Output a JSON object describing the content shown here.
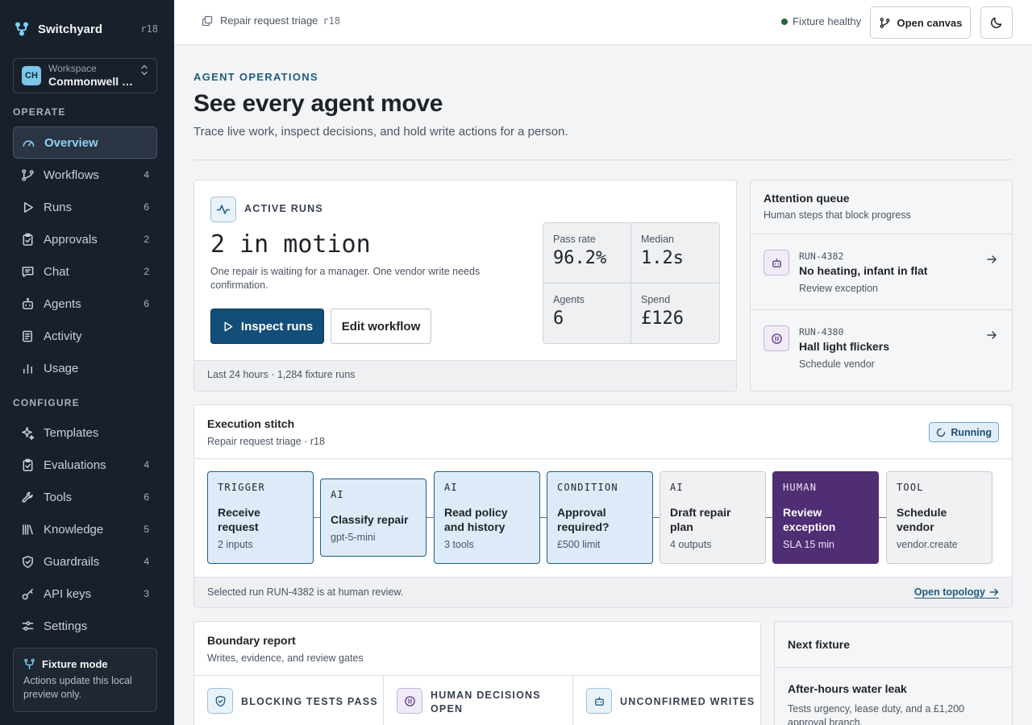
{
  "app": {
    "name": "Switchyard",
    "version": "r18"
  },
  "workspace": {
    "label": "Workspace",
    "initials": "CH",
    "name": "Commonwell Housing"
  },
  "nav": {
    "operate_label": "OPERATE",
    "configure_label": "CONFIGURE",
    "operate": [
      {
        "label": "Overview",
        "count": "",
        "icon": "gauge-icon",
        "active": true
      },
      {
        "label": "Workflows",
        "count": "4",
        "icon": "branch-icon"
      },
      {
        "label": "Runs",
        "count": "6",
        "icon": "play-icon"
      },
      {
        "label": "Approvals",
        "count": "2",
        "icon": "clipboard-check-icon"
      },
      {
        "label": "Chat",
        "count": "2",
        "icon": "chat-icon"
      },
      {
        "label": "Agents",
        "count": "6",
        "icon": "robot-icon"
      },
      {
        "label": "Activity",
        "count": "",
        "icon": "activity-log-icon"
      },
      {
        "label": "Usage",
        "count": "",
        "icon": "bar-chart-icon"
      }
    ],
    "configure": [
      {
        "label": "Templates",
        "count": "",
        "icon": "sparkle-icon"
      },
      {
        "label": "Evaluations",
        "count": "4",
        "icon": "clipboard-check-icon"
      },
      {
        "label": "Tools",
        "count": "6",
        "icon": "wrench-icon"
      },
      {
        "label": "Knowledge",
        "count": "5",
        "icon": "library-icon"
      },
      {
        "label": "Guardrails",
        "count": "4",
        "icon": "shield-check-icon"
      },
      {
        "label": "API keys",
        "count": "3",
        "icon": "key-icon"
      },
      {
        "label": "Settings",
        "count": "",
        "icon": "sliders-icon"
      }
    ]
  },
  "fixture_mode": {
    "title": "Fixture mode",
    "description": "Actions update this local preview only."
  },
  "topbar": {
    "breadcrumb": "Repair request triage",
    "breadcrumb_version": "r18",
    "health": "Fixture healthy",
    "open_canvas": "Open canvas"
  },
  "header": {
    "eyebrow": "AGENT OPERATIONS",
    "title": "See every agent move",
    "subtitle": "Trace live work, inspect decisions, and hold write actions for a person."
  },
  "active_runs": {
    "label": "ACTIVE RUNS",
    "headline": "2 in motion",
    "description": "One repair is waiting for a manager. One vendor write needs confirmation.",
    "primary_button": "Inspect runs",
    "secondary_button": "Edit workflow",
    "stats": [
      {
        "label": "Pass rate",
        "value": "96.2%"
      },
      {
        "label": "Median",
        "value": "1.2s"
      },
      {
        "label": "Agents",
        "value": "6"
      },
      {
        "label": "Spend",
        "value": "£126"
      }
    ],
    "footer": "Last 24 hours · 1,284 fixture runs"
  },
  "attention_queue": {
    "title": "Attention queue",
    "subtitle": "Human steps that block progress",
    "items": [
      {
        "id": "RUN-4382",
        "title": "No heating, infant in flat",
        "action": "Review exception",
        "icon": "robot-icon"
      },
      {
        "id": "RUN-4380",
        "title": "Hall light flickers",
        "action": "Schedule vendor",
        "icon": "pause-circle-icon"
      }
    ]
  },
  "execution": {
    "title": "Execution stitch",
    "subtitle": "Repair request triage · r18",
    "status": "Running",
    "nodes": [
      {
        "kind": "TRIGGER",
        "title": "Receive request",
        "meta": "2 inputs",
        "state": "done"
      },
      {
        "kind": "AI",
        "title": "Classify repair",
        "meta": "gpt-5-mini",
        "state": "done"
      },
      {
        "kind": "AI",
        "title": "Read policy and history",
        "meta": "3 tools",
        "state": "done"
      },
      {
        "kind": "CONDITION",
        "title": "Approval required?",
        "meta": "£500 limit",
        "state": "done"
      },
      {
        "kind": "AI",
        "title": "Draft repair plan",
        "meta": "4 outputs",
        "state": "pending"
      },
      {
        "kind": "HUMAN",
        "title": "Review exception",
        "meta": "SLA 15 min",
        "state": "current"
      },
      {
        "kind": "TOOL",
        "title": "Schedule vendor",
        "meta": "vendor.create",
        "state": "pending"
      }
    ],
    "footer": "Selected run RUN-4382 is at human review.",
    "footer_link": "Open topology"
  },
  "boundary": {
    "title": "Boundary report",
    "subtitle": "Writes, evidence, and review gates",
    "columns": [
      {
        "label": "BLOCKING TESTS PASS",
        "icon": "shield-check-icon"
      },
      {
        "label": "HUMAN DECISIONS OPEN",
        "icon": "pause-circle-icon"
      },
      {
        "label": "UNCONFIRMED WRITES",
        "icon": "robot-icon"
      }
    ]
  },
  "next_fixture": {
    "title": "Next fixture",
    "item_title": "After-hours water leak",
    "item_description": "Tests urgency, lease duty, and a £1,200 approval branch."
  },
  "colors": {
    "sidebar_bg": "#18202b",
    "accent": "#134e78",
    "active_nav": "#8fd3f5",
    "human_node": "#4f2e73",
    "healthy": "#1d6b3a"
  }
}
